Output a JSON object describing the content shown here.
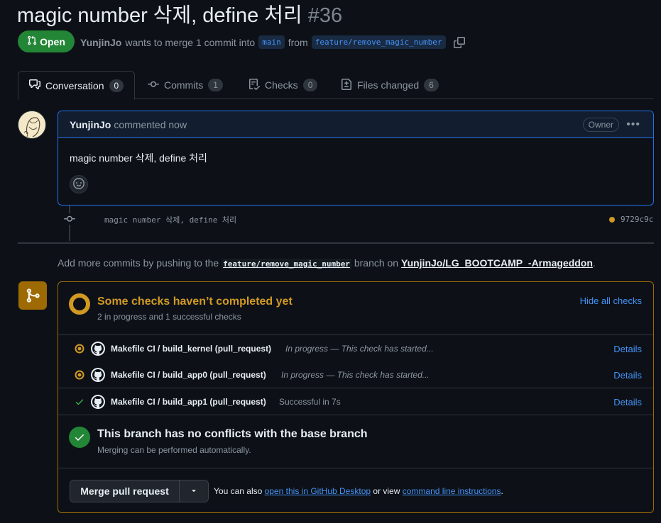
{
  "pr": {
    "title": "magic number 삭제, define 처리",
    "number": "#36",
    "state": "Open",
    "author": "YunjinJo",
    "meta_text": "wants to merge 1 commit into",
    "base_branch": "main",
    "from_text": "from",
    "head_branch": "feature/remove_magic_number"
  },
  "tabs": [
    {
      "label": "Conversation",
      "count": "0"
    },
    {
      "label": "Commits",
      "count": "1"
    },
    {
      "label": "Checks",
      "count": "0"
    },
    {
      "label": "Files changed",
      "count": "6"
    }
  ],
  "comment": {
    "author": "YunjinJo",
    "time_text": "commented now",
    "role_badge": "Owner",
    "body": "magic number 삭제, define 처리"
  },
  "commit": {
    "message": "magic number 삭제, define 처리",
    "sha": "9729c9c"
  },
  "push_hint": {
    "prefix": "Add more commits by pushing to the",
    "branch": "feature/remove_magic_number",
    "middle": "branch on",
    "repo": "YunjinJo/LG_BOOTCAMP_-Armageddon",
    "suffix": "."
  },
  "checks": {
    "title": "Some checks haven’t completed yet",
    "subtitle": "2 in progress and 1 successful checks",
    "hide_label": "Hide all checks",
    "items": [
      {
        "name": "Makefile CI / build_kernel (pull_request)",
        "status": "in_progress",
        "desc": "In progress — This check has started...",
        "link": "Details"
      },
      {
        "name": "Makefile CI / build_app0 (pull_request)",
        "status": "in_progress",
        "desc": "In progress — This check has started...",
        "link": "Details"
      },
      {
        "name": "Makefile CI / build_app1 (pull_request)",
        "status": "success",
        "desc": "Successful in 7s",
        "link": "Details"
      }
    ]
  },
  "conflicts": {
    "title": "This branch has no conflicts with the base branch",
    "subtitle": "Merging can be performed automatically."
  },
  "merge": {
    "button_label": "Merge pull request",
    "alt_prefix": "You can also",
    "desktop_link": "open this in GitHub Desktop",
    "alt_middle": "or view",
    "cli_link": "command line instructions",
    "alt_suffix": "."
  },
  "colors": {
    "accent_blue": "#4493f8",
    "open_green": "#238636",
    "pending_yellow": "#d29922",
    "success_green": "#3fb950"
  }
}
